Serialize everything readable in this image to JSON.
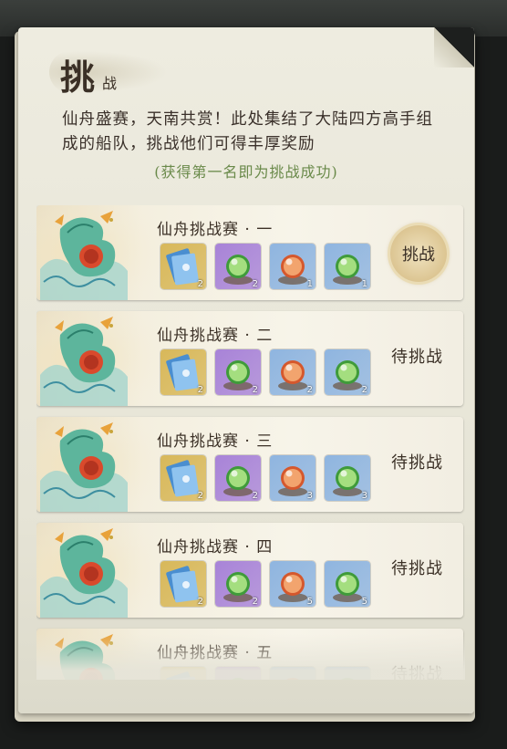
{
  "panel": {
    "title": "挑",
    "title_sub": "战",
    "intro": "仙舟盛赛，天南共赏！此处集结了大陆四方高手组成的船队，挑战他们可得丰厚奖励",
    "note": "(获得第一名即为挑战成功)"
  },
  "challenges": [
    {
      "title": "仙舟挑战赛 · 一",
      "action": "挑战",
      "rewards": [
        {
          "icon": "ticket-card-icon",
          "count": "2",
          "color": "#d8b85a"
        },
        {
          "icon": "green-orb-icon",
          "count": "2",
          "color": "#a883d8"
        },
        {
          "icon": "orange-orb-icon",
          "count": "1",
          "color": "#8fb5e0"
        },
        {
          "icon": "green-orb-icon",
          "count": "1",
          "color": "#8fb5e0"
        }
      ]
    },
    {
      "title": "仙舟挑战赛 · 二",
      "action": "待挑战",
      "rewards": [
        {
          "icon": "ticket-card-icon",
          "count": "2",
          "color": "#d8b85a"
        },
        {
          "icon": "green-orb-icon",
          "count": "2",
          "color": "#a883d8"
        },
        {
          "icon": "orange-orb-icon",
          "count": "2",
          "color": "#8fb5e0"
        },
        {
          "icon": "green-orb-icon",
          "count": "2",
          "color": "#8fb5e0"
        }
      ]
    },
    {
      "title": "仙舟挑战赛 · 三",
      "action": "待挑战",
      "rewards": [
        {
          "icon": "ticket-card-icon",
          "count": "2",
          "color": "#d8b85a"
        },
        {
          "icon": "green-orb-icon",
          "count": "2",
          "color": "#a883d8"
        },
        {
          "icon": "orange-orb-icon",
          "count": "3",
          "color": "#8fb5e0"
        },
        {
          "icon": "green-orb-icon",
          "count": "3",
          "color": "#8fb5e0"
        }
      ]
    },
    {
      "title": "仙舟挑战赛 · 四",
      "action": "待挑战",
      "rewards": [
        {
          "icon": "ticket-card-icon",
          "count": "2",
          "color": "#d8b85a"
        },
        {
          "icon": "green-orb-icon",
          "count": "2",
          "color": "#a883d8"
        },
        {
          "icon": "orange-orb-icon",
          "count": "5",
          "color": "#8fb5e0"
        },
        {
          "icon": "green-orb-icon",
          "count": "5",
          "color": "#8fb5e0"
        }
      ]
    },
    {
      "title": "仙舟挑战赛 · 五",
      "action": "待挑战",
      "rewards": [
        {
          "icon": "ticket-card-icon",
          "count": "",
          "color": "#d8b85a"
        },
        {
          "icon": "green-orb-icon",
          "count": "",
          "color": "#a883d8"
        },
        {
          "icon": "orange-orb-icon",
          "count": "",
          "color": "#8fb5e0"
        },
        {
          "icon": "green-orb-icon",
          "count": "",
          "color": "#8fb5e0"
        }
      ]
    }
  ]
}
